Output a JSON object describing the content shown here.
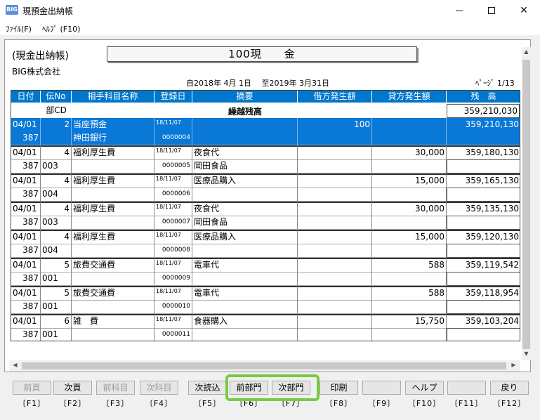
{
  "window": {
    "app_icon": "BIG",
    "title": "現預金出納帳",
    "minimize": "minimize-icon",
    "maximize": "maximize-icon",
    "close": "close-icon"
  },
  "menu": {
    "file": "ﾌｧｲﾙ(F)",
    "help": "ﾍﾙﾌﾟ (F10)"
  },
  "report": {
    "label": "(現金出納帳)",
    "account": "100現　　金",
    "company": "BIG株式会社",
    "period": "自2018年 4月 1日　 至2019年 3月31日",
    "page": "ﾍﾟｰｼﾞ 1/13"
  },
  "columns": [
    "日付",
    "伝No",
    "相手科目名称",
    "登録日",
    "摘要",
    "借方発生額",
    "貸方発生額",
    "残　高"
  ],
  "carry": {
    "dept_label": "部CD",
    "label": "繰越残高",
    "balance": "359,210,030"
  },
  "entries": [
    {
      "date": "04/01",
      "no": "2",
      "account": "当座預金",
      "regdate": "18/11/07",
      "desc": "",
      "debit": "100",
      "credit": "",
      "balance": "359,210,130",
      "code": "387",
      "sub": "",
      "subname": "神田銀行",
      "seq": "0000004",
      "desc2": ""
    },
    {
      "date": "04/01",
      "no": "4",
      "account": "福利厚生費",
      "regdate": "18/11/07",
      "desc": "夜食代",
      "debit": "",
      "credit": "30,000",
      "balance": "359,180,130",
      "code": "387",
      "sub": "003",
      "subname": "",
      "seq": "0000005",
      "desc2": "岡田食品"
    },
    {
      "date": "04/01",
      "no": "4",
      "account": "福利厚生費",
      "regdate": "18/11/07",
      "desc": "医療品購入",
      "debit": "",
      "credit": "15,000",
      "balance": "359,165,130",
      "code": "387",
      "sub": "004",
      "subname": "",
      "seq": "0000006",
      "desc2": ""
    },
    {
      "date": "04/01",
      "no": "4",
      "account": "福利厚生費",
      "regdate": "18/11/07",
      "desc": "夜食代",
      "debit": "",
      "credit": "30,000",
      "balance": "359,135,130",
      "code": "387",
      "sub": "003",
      "subname": "",
      "seq": "0000007",
      "desc2": "岡田食品"
    },
    {
      "date": "04/01",
      "no": "4",
      "account": "福利厚生費",
      "regdate": "18/11/07",
      "desc": "医療品購入",
      "debit": "",
      "credit": "15,000",
      "balance": "359,120,130",
      "code": "387",
      "sub": "004",
      "subname": "",
      "seq": "0000008",
      "desc2": ""
    },
    {
      "date": "04/01",
      "no": "5",
      "account": "旅費交通費",
      "regdate": "18/11/07",
      "desc": "電車代",
      "debit": "",
      "credit": "588",
      "balance": "359,119,542",
      "code": "387",
      "sub": "001",
      "subname": "",
      "seq": "0000009",
      "desc2": ""
    },
    {
      "date": "04/01",
      "no": "5",
      "account": "旅費交通費",
      "regdate": "18/11/07",
      "desc": "電車代",
      "debit": "",
      "credit": "588",
      "balance": "359,118,954",
      "code": "387",
      "sub": "001",
      "subname": "",
      "seq": "0000010",
      "desc2": ""
    },
    {
      "date": "04/01",
      "no": "6",
      "account": "雑　費",
      "regdate": "18/11/07",
      "desc": "食器購入",
      "debit": "",
      "credit": "15,750",
      "balance": "359,103,204",
      "code": "387",
      "sub": "001",
      "subname": "",
      "seq": "0000011",
      "desc2": ""
    }
  ],
  "fkeys": [
    {
      "label": "前頁",
      "key": "〔F1〕",
      "disabled": true
    },
    {
      "label": "次頁",
      "key": "〔F2〕",
      "disabled": false
    },
    {
      "label": "前科目",
      "key": "〔F3〕",
      "disabled": true
    },
    {
      "label": "次科目",
      "key": "〔F4〕",
      "disabled": true
    },
    {
      "label": "次読込",
      "key": "〔F5〕",
      "disabled": false
    },
    {
      "label": "前部門",
      "key": "〔F6〕",
      "disabled": false
    },
    {
      "label": "次部門",
      "key": "〔F7〕",
      "disabled": false
    },
    {
      "label": "印刷",
      "key": "〔F8〕",
      "disabled": false
    },
    {
      "label": "",
      "key": "〔F9〕",
      "disabled": false
    },
    {
      "label": "ヘルプ",
      "key": "〔F10〕",
      "disabled": false
    },
    {
      "label": "",
      "key": "〔F11〕",
      "disabled": false
    },
    {
      "label": "戻り",
      "key": "〔F12〕",
      "disabled": false
    }
  ],
  "colors": {
    "header": "#0077cc",
    "selected": "#0a78d7",
    "highlight": "#7ac943"
  }
}
